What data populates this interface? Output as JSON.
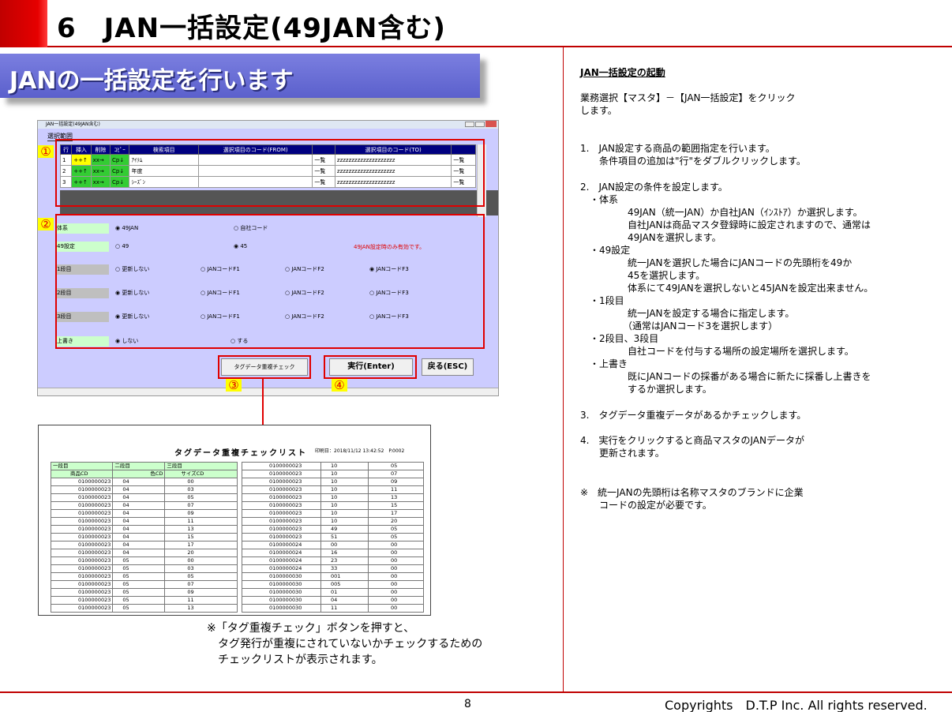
{
  "header": {
    "title": "6　JAN一括設定(49JAN含む)"
  },
  "banner": {
    "text": "JANの一括設定を行います"
  },
  "window": {
    "title": "JAN一括設定(49JAN含む)",
    "section_label": "選択範囲",
    "grid_headers": [
      "行",
      "挿入",
      "削除",
      "ｺﾋﾟｰ",
      "検索項目",
      "選択項目のコード(FROM)",
      "",
      "選択項目のコード(TO)",
      ""
    ],
    "rows": [
      {
        "no": "1",
        "ins": "++↑",
        "del": "xx→",
        "cp": "Cp↓",
        "item": "ｱｲﾃﾑ",
        "from": "",
        "btn1": "一覧",
        "to": "zzzzzzzzzzzzzzzzzzzz",
        "btn2": "一覧"
      },
      {
        "no": "2",
        "ins": "++↑",
        "del": "xx→",
        "cp": "Cp↓",
        "item": "年度",
        "from": "",
        "btn1": "一覧",
        "to": "zzzzzzzzzzzzzzzzzzzz",
        "btn2": "一覧"
      },
      {
        "no": "3",
        "ins": "++↑",
        "del": "xx→",
        "cp": "Cp↓",
        "item": "ｼｰｽﾞﾝ",
        "from": "",
        "btn1": "一覧",
        "to": "zzzzzzzzzzzzzzzzzzzz",
        "btn2": "一覧"
      }
    ],
    "settings": {
      "taikei": {
        "label": "体系",
        "opt1": "◉ 49JAN",
        "opt2": "○ 自社コード"
      },
      "s49": {
        "label": "49設定",
        "opt1": "○ 49",
        "opt2": "◉ 45",
        "note": "49JAN設定時のみ有効です。"
      },
      "dan1": {
        "label": "1段目",
        "o1": "○ 更新しない",
        "o2": "○ JANコードF1",
        "o3": "○ JANコードF2",
        "o4": "◉ JANコードF3"
      },
      "dan2": {
        "label": "2段目",
        "o1": "◉ 更新しない",
        "o2": "○ JANコードF1",
        "o3": "○ JANコードF2",
        "o4": "○ JANコードF3"
      },
      "dan3": {
        "label": "3段目",
        "o1": "◉ 更新しない",
        "o2": "○ JANコードF1",
        "o3": "○ JANコードF2",
        "o4": "○ JANコードF3"
      },
      "uwagaki": {
        "label": "上書き",
        "opt1": "◉ しない",
        "opt2": "○ する"
      }
    },
    "buttons": {
      "tag_check": "タグデータ重複チェック",
      "execute": "実行(Enter)",
      "back": "戻る(ESC)"
    }
  },
  "markers": {
    "m1": "①",
    "m2": "②",
    "m3": "③",
    "m4": "④"
  },
  "checklist": {
    "title": "タグデータ重複チェックリスト",
    "print_info": "印刷日：2018/11/12 13:42:52　P.0002",
    "left_headers1": [
      "一段目",
      "二段目",
      "三段目"
    ],
    "left_headers2": [
      "商品CD",
      "色CD",
      "サイズCD"
    ],
    "left_rows": [
      [
        "0100000023",
        "04",
        "00"
      ],
      [
        "0100000023",
        "04",
        "03"
      ],
      [
        "0100000023",
        "04",
        "05"
      ],
      [
        "0100000023",
        "04",
        "07"
      ],
      [
        "0100000023",
        "04",
        "09"
      ],
      [
        "0100000023",
        "04",
        "11"
      ],
      [
        "0100000023",
        "04",
        "13"
      ],
      [
        "0100000023",
        "04",
        "15"
      ],
      [
        "0100000023",
        "04",
        "17"
      ],
      [
        "0100000023",
        "04",
        "20"
      ],
      [
        "0100000023",
        "05",
        "00"
      ],
      [
        "0100000023",
        "05",
        "03"
      ],
      [
        "0100000023",
        "05",
        "05"
      ],
      [
        "0100000023",
        "05",
        "07"
      ],
      [
        "0100000023",
        "05",
        "09"
      ],
      [
        "0100000023",
        "05",
        "11"
      ],
      [
        "0100000023",
        "05",
        "13"
      ]
    ],
    "right_rows": [
      [
        "0100000023",
        "10",
        "05"
      ],
      [
        "0100000023",
        "10",
        "07"
      ],
      [
        "0100000023",
        "10",
        "09"
      ],
      [
        "0100000023",
        "10",
        "11"
      ],
      [
        "0100000023",
        "10",
        "13"
      ],
      [
        "0100000023",
        "10",
        "15"
      ],
      [
        "0100000023",
        "10",
        "17"
      ],
      [
        "0100000023",
        "10",
        "20"
      ],
      [
        "0100000023",
        "49",
        "05"
      ],
      [
        "0100000023",
        "51",
        "05"
      ],
      [
        "0100000024",
        "00",
        "00"
      ],
      [
        "0100000024",
        "16",
        "00"
      ],
      [
        "0100000024",
        "23",
        "00"
      ],
      [
        "0100000024",
        "33",
        "00"
      ],
      [
        "0100000030",
        "001",
        "00"
      ],
      [
        "0100000030",
        "005",
        "00"
      ],
      [
        "0100000030",
        "01",
        "00"
      ],
      [
        "0100000030",
        "04",
        "00"
      ],
      [
        "0100000030",
        "11",
        "00"
      ]
    ]
  },
  "note_bottom": "※「タグ重複チェック」ボタンを押すと、\n　タグ発行が重複にされていないかチェックするための\n　チェックリストが表示されます。",
  "right_panel": {
    "heading": "JAN一括設定の起動",
    "intro": "業務選択【マスタ】－【JAN一括設定】をクリック\nします。",
    "step1": "1.　JAN設定する商品の範囲指定を行います。\n　　条件項目の追加は\"行\"をダブルクリックします。",
    "step2": "2.　JAN設定の条件を設定します。\n　・体系\n　　　　　49JAN（統一JAN）か自社JAN（ｲﾝｽﾄｱ）か選択します。\n　　　　　自社JANは商品マスタ登録時に設定されますので、通常は\n　　　　　49JANを選択します。\n　・49設定\n　　　　　統一JANを選択した場合にJANコードの先頭桁を49か\n　　　　　45を選択します。\n　　　　　体系にて49JANを選択しないと45JANを設定出来ません。\n　・1段目\n　　　　　統一JANを設定する場合に指定します。\n　　　　　（通常はJANコード3を選択します）\n　・2段目、3段目\n　　　　　自社コードを付与する場所の設定場所を選択します。\n　・上書き\n　　　　　既にJANコードの採番がある場合に新たに採番し上書きを\n　　　　　するか選択します。",
    "step3": "3.　タグデータ重複データがあるかチェックします。",
    "step4": "4.　実行をクリックすると商品マスタのJANデータが\n　　更新されます。",
    "note": "※　統一JANの先頭桁は名称マスタのブランドに企業\n　　コードの設定が必要です。"
  },
  "footer": {
    "page": "8",
    "copyright": "Copyrights　D.T.P Inc. All rights reserved."
  }
}
